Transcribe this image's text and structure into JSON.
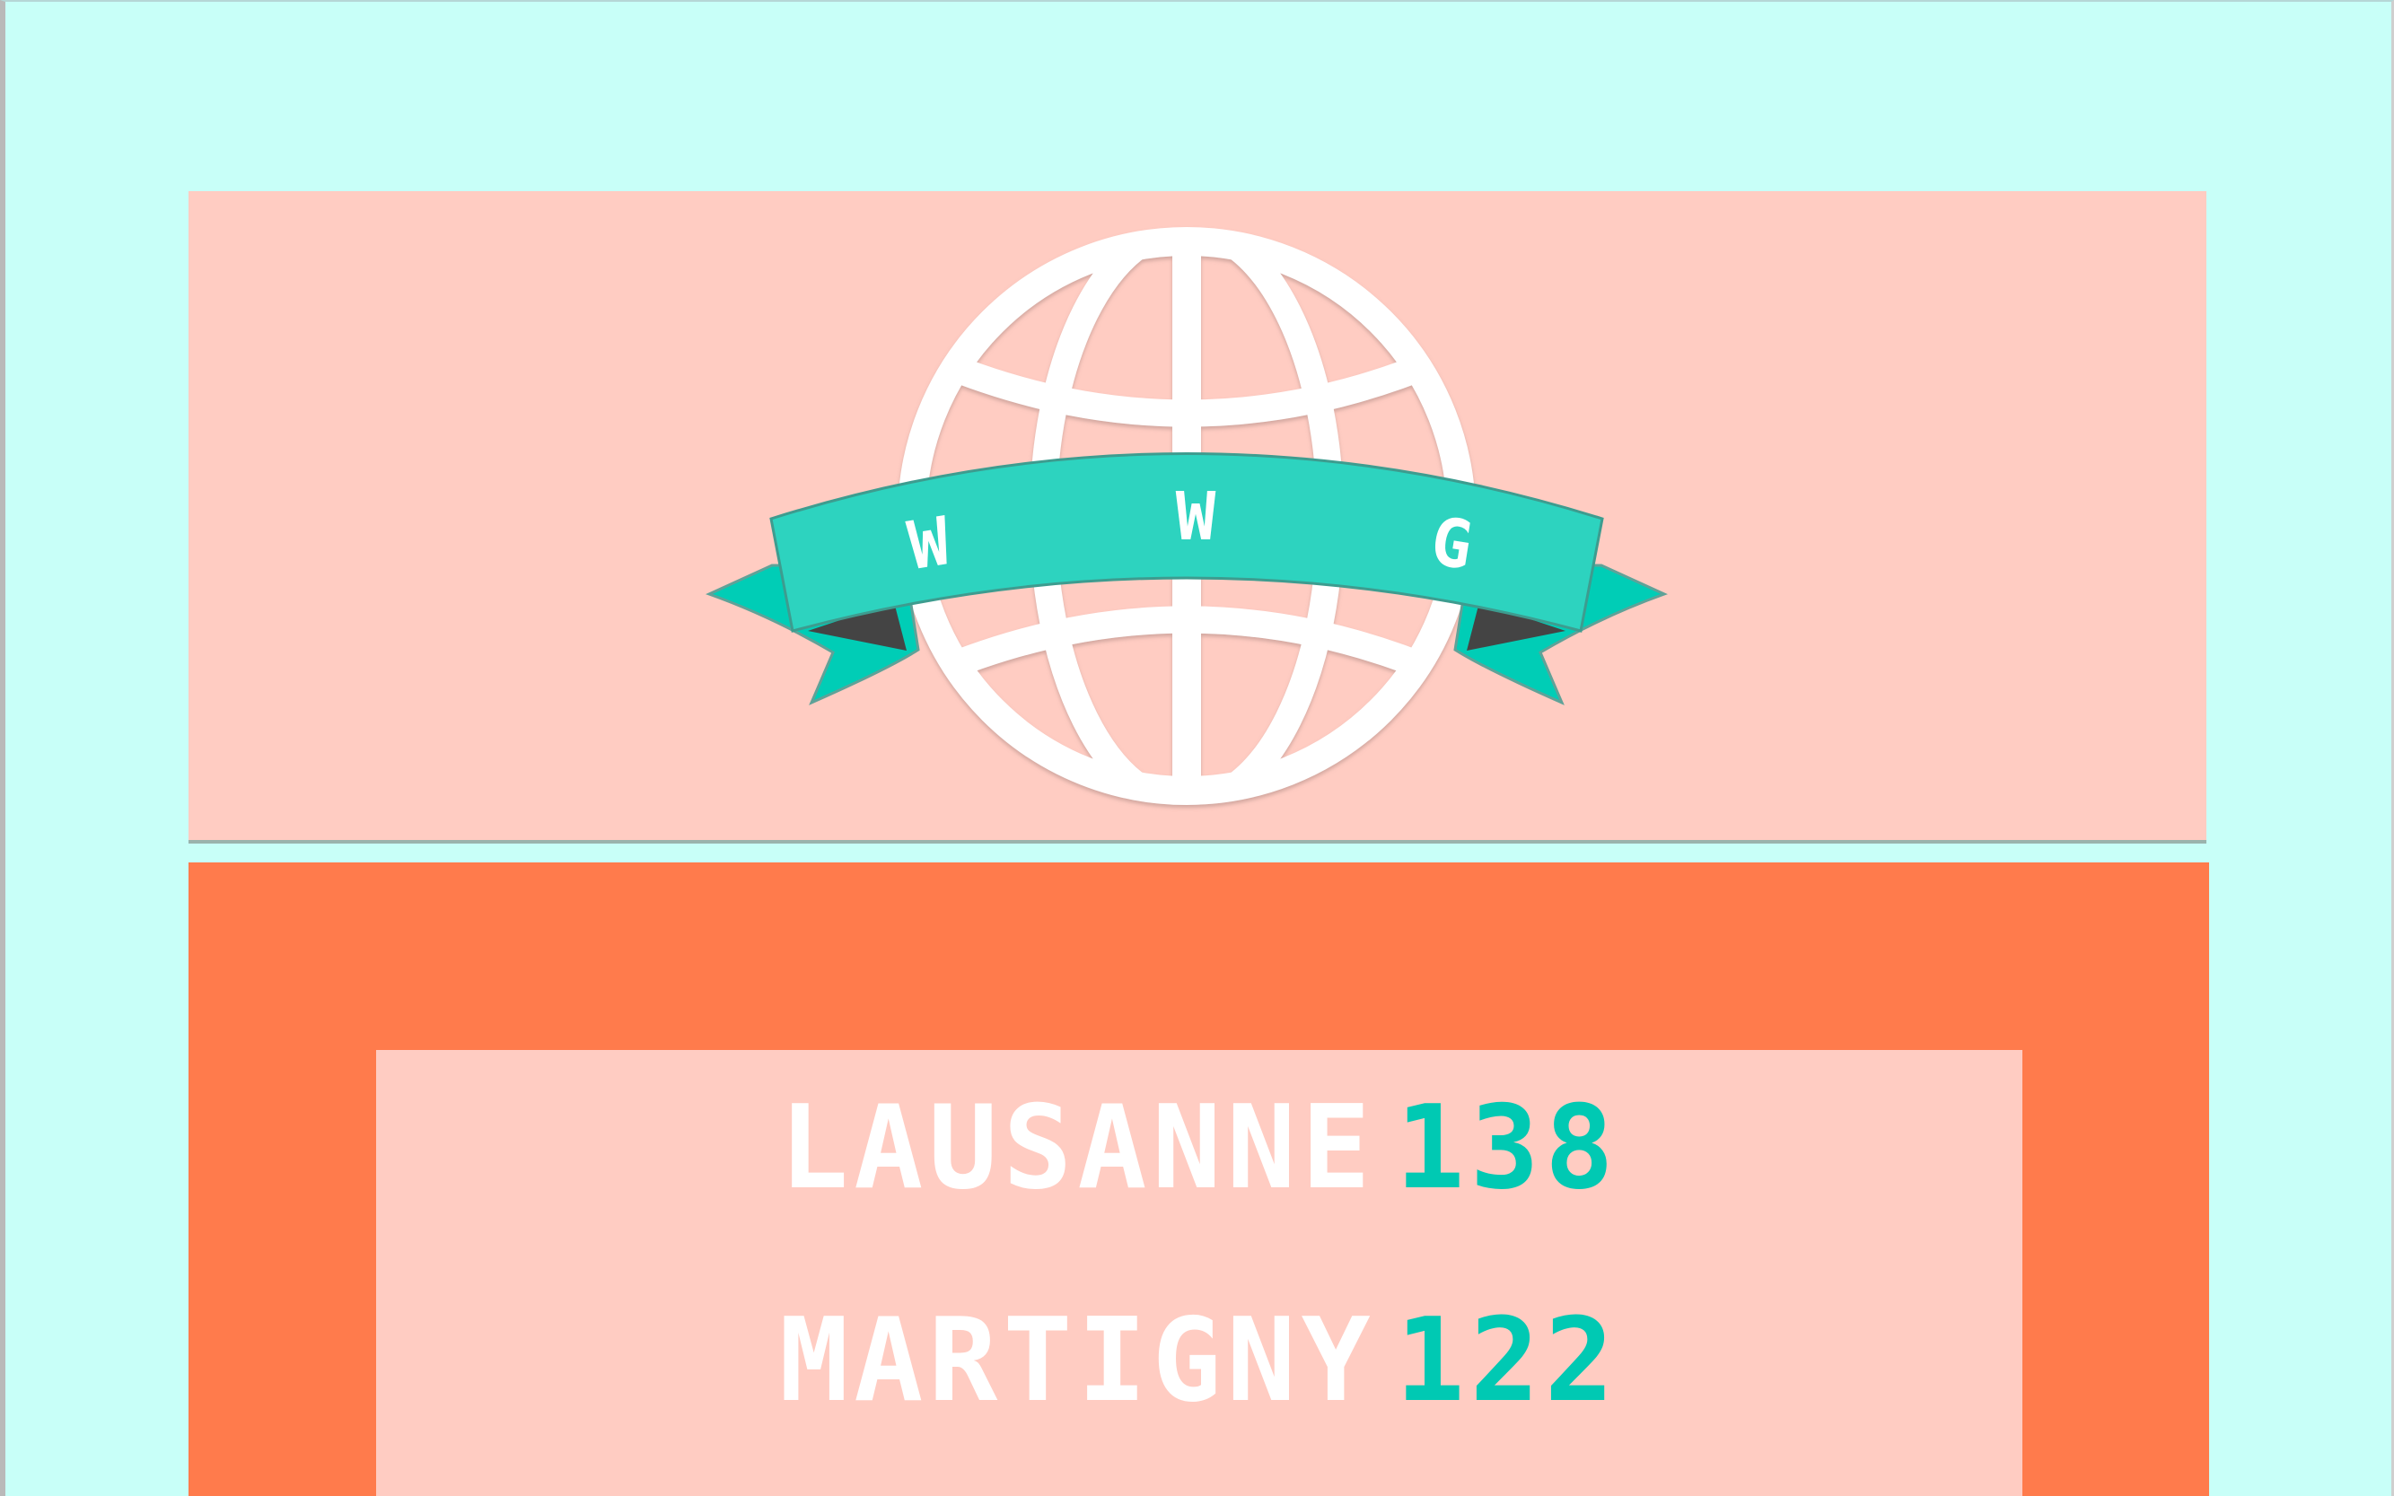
{
  "logo": {
    "letters": [
      "W",
      "W",
      "G"
    ],
    "colors": {
      "banner": "#2dd3bf",
      "banner_tails": "#00cdb6",
      "banner_fold": "#444444",
      "globe": "#ffffff",
      "panel": "#ffccc2"
    },
    "icon": "globe-icon"
  },
  "scores": [
    {
      "team": "LAUSANNE",
      "score": "138"
    },
    {
      "team": "MARTIGNY",
      "score": "122"
    }
  ],
  "colors": {
    "background": "#c8fff8",
    "frame": "#ff7b4c",
    "score_panel": "#ffccc2",
    "team_text": "#ffffff",
    "score_text": "#00c9b3"
  }
}
